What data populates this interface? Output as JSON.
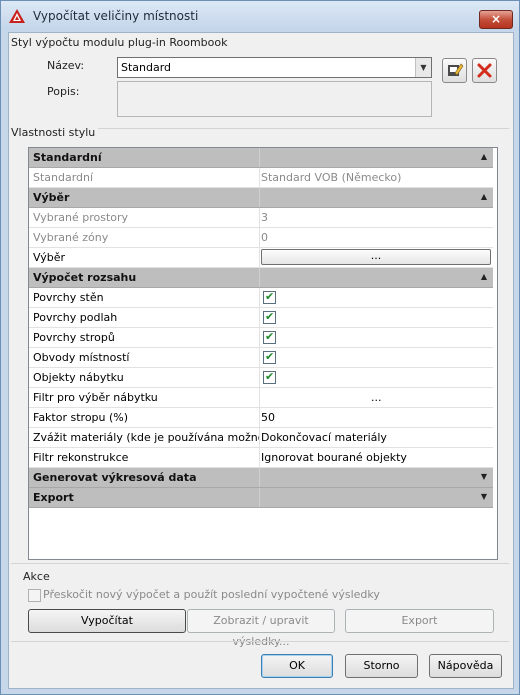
{
  "window": {
    "title": "Vypočítat veličiny místnosti",
    "close_label": "×"
  },
  "style_group": {
    "title": "Styl výpočtu modulu plug-in Roombook",
    "name_label": "Název:",
    "name_value": "Standard",
    "description_label": "Popis:",
    "description_value": ""
  },
  "properties_group": {
    "title": "Vlastnosti stylu",
    "rows": [
      {
        "type": "category",
        "name": "Standardní",
        "expanded": true
      },
      {
        "type": "text",
        "name": "Standardní",
        "value": "Standard VOB (Německo)",
        "disabled": true
      },
      {
        "type": "category",
        "name": "Výběr",
        "expanded": true
      },
      {
        "type": "text",
        "name": "Vybrané prostory",
        "value": "3",
        "disabled": true
      },
      {
        "type": "text",
        "name": "Vybrané zóny",
        "value": "0",
        "disabled": true
      },
      {
        "type": "button",
        "name": "Výběr",
        "value": "..."
      },
      {
        "type": "category",
        "name": "Výpočet rozsahu",
        "expanded": true
      },
      {
        "type": "check",
        "name": "Povrchy stěn",
        "checked": true
      },
      {
        "type": "check",
        "name": "Povrchy podlah",
        "checked": true
      },
      {
        "type": "check",
        "name": "Povrchy stropů",
        "checked": true
      },
      {
        "type": "check",
        "name": "Obvody místností",
        "checked": true
      },
      {
        "type": "check",
        "name": "Objekty nábytku",
        "checked": true
      },
      {
        "type": "ellipsis",
        "name": "Filtr pro výběr nábytku",
        "value": "..."
      },
      {
        "type": "text",
        "name": "Faktor stropu (%)",
        "value": "50"
      },
      {
        "type": "text",
        "name": "Zvážit materiály (kde je používána možnost",
        "value": "Dokončovací materiály"
      },
      {
        "type": "text",
        "name": "Filtr rekonstrukce",
        "value": "Ignorovat bourané objekty"
      },
      {
        "type": "category",
        "name": "Generovat výkresová data",
        "expanded": false
      },
      {
        "type": "category",
        "name": "Export",
        "expanded": false
      }
    ]
  },
  "actions_group": {
    "title": "Akce",
    "skip_checkbox_label": "Přeskočit nový výpočet a použít poslední vypočtené výsledky",
    "skip_checked": false,
    "calculate_label": "Vypočítat",
    "view_edit_label": "Zobrazit / upravit výsledky...",
    "export_label": "Export"
  },
  "footer": {
    "ok_label": "OK",
    "cancel_label": "Storno",
    "help_label": "Nápověda"
  },
  "icons": {
    "up_arrow": "▲",
    "down_arrow": "▼",
    "check_mark": "✔"
  }
}
